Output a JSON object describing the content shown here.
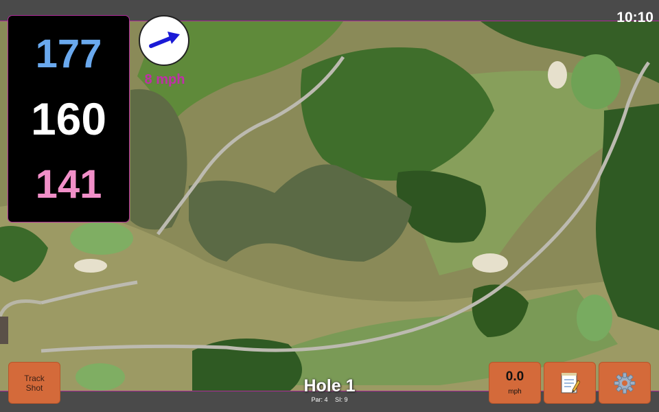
{
  "status_bar": {
    "clock": "10:10"
  },
  "distances": {
    "back": "177",
    "middle": "160",
    "front": "141"
  },
  "wind": {
    "speed": "8 mph",
    "direction_icon": "arrow-icon",
    "arrow_color": "#1a1ad6"
  },
  "hole": {
    "title": "Hole 1",
    "par": "Par: 4",
    "stroke_index": "SI: 9"
  },
  "buttons": {
    "track_shot": "Track\nShot",
    "speed_value": "0.0",
    "speed_unit": "mph",
    "notes_icon": "notepad-icon",
    "settings_icon": "gear-icon"
  },
  "colors": {
    "back_distance": "#6aa9ee",
    "middle_distance": "#ffffff",
    "front_distance": "#f18fc8",
    "button": "#d46a3a",
    "accent": "#b02a9a"
  }
}
